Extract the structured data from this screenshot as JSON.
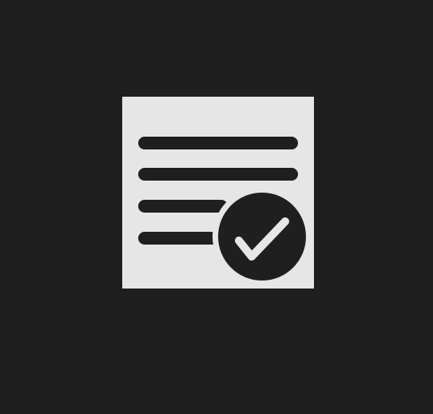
{
  "icon": {
    "name": "document-checked-icon",
    "background_color": "#1f1f1f",
    "tile_color": "#e6e6e6",
    "glyph_color": "#1f1f1f",
    "check_color": "#e6e6e6"
  }
}
